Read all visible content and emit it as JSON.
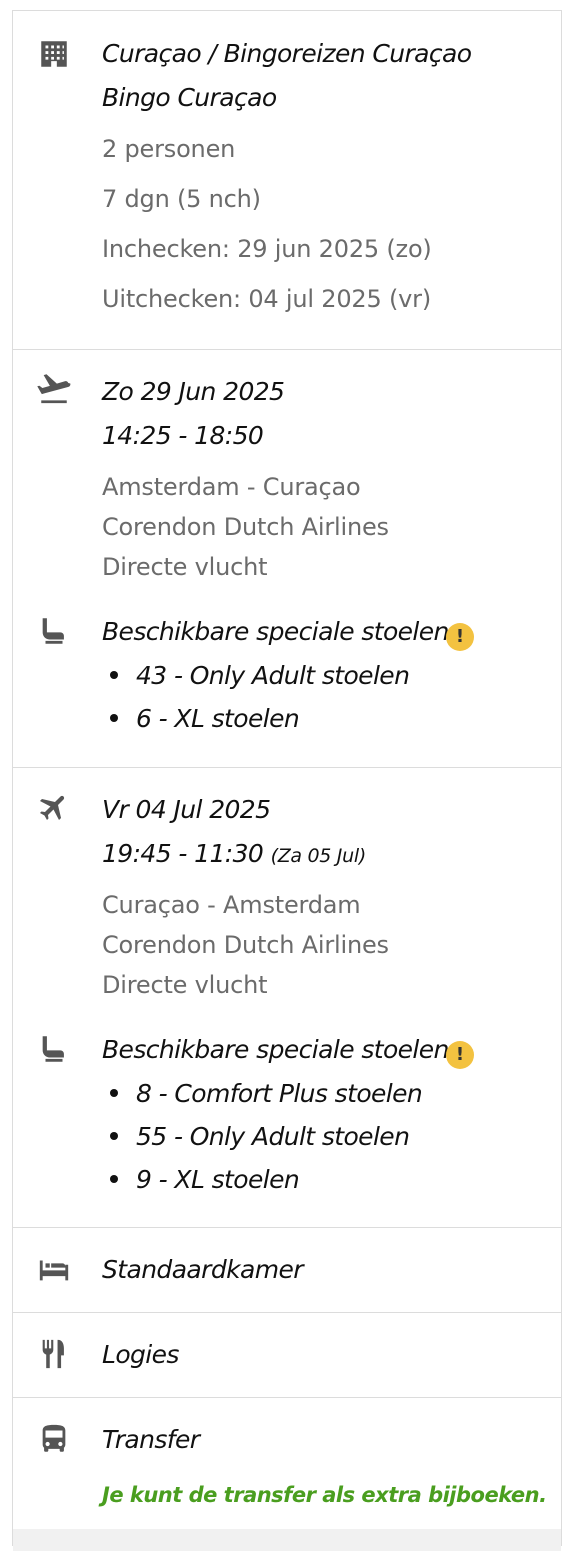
{
  "hotel": {
    "icon": "building-icon",
    "title_line1": "Curaçao / Bingoreizen Curaçao",
    "title_line2": "Bingo Curaçao",
    "persons": "2 personen",
    "duration": "7 dgn (5 nch)",
    "checkin": "Inchecken: 29 jun 2025 (zo)",
    "checkout": "Uitchecken: 04 jul 2025 (vr)"
  },
  "outbound": {
    "icon": "plane-departure-icon",
    "date": "Zo 29 Jun 2025",
    "time": "14:25 - 18:50",
    "route": "Amsterdam - Curaçao",
    "airline": "Corendon Dutch Airlines",
    "type": "Directe vlucht",
    "seats_icon": "seat-icon",
    "seats_title": "Beschikbare speciale stoelen:",
    "warning": "!",
    "seats": [
      "43 - Only Adult stoelen",
      "6 - XL stoelen"
    ]
  },
  "return": {
    "icon": "plane-arrival-icon",
    "date": "Vr 04 Jul 2025",
    "time": "19:45 - 11:30",
    "time_note": "(Za 05 Jul)",
    "route": "Curaçao - Amsterdam",
    "airline": "Corendon Dutch Airlines",
    "type": "Directe vlucht",
    "seats_icon": "seat-icon",
    "seats_title": "Beschikbare speciale stoelen:",
    "warning": "!",
    "seats": [
      "8 - Comfort Plus stoelen",
      "55 - Only Adult stoelen",
      "9 - XL stoelen"
    ]
  },
  "room": {
    "icon": "bed-icon",
    "label": "Standaardkamer"
  },
  "board": {
    "icon": "cutlery-icon",
    "label": "Logies"
  },
  "transfer": {
    "icon": "bus-icon",
    "label": "Transfer",
    "note": "Je kunt de transfer als extra bijboeken."
  },
  "colors": {
    "accent_green": "#4a9e1f",
    "warning_yellow": "#f3c240",
    "muted_text": "#6b6b6b"
  }
}
